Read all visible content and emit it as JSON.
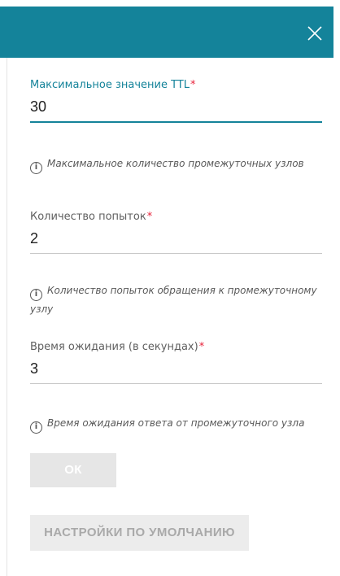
{
  "dialog": {
    "close_icon": "close-icon",
    "header_color": "#14839a"
  },
  "fields": {
    "ttl": {
      "label": "Максимальное значение TTL",
      "required_mark": "*",
      "value": "30",
      "hint": "Максимальное количество промежуточных узлов"
    },
    "attempts": {
      "label": "Количество попыток",
      "required_mark": "*",
      "value": "2",
      "hint": "Количество попыток обращения к промежуточному узлу"
    },
    "timeout": {
      "label": "Время ожидания (в секундах)",
      "required_mark": "*",
      "value": "3",
      "hint": "Время ожидания ответа от промежуточного узла"
    }
  },
  "hint_icon": "info-icon",
  "buttons": {
    "ok_label": "ОК",
    "defaults_label": "НАСТРОЙКИ ПО УМОЛЧАНИЮ"
  },
  "colors": {
    "accent": "#14839a",
    "required": "#e8243c",
    "button_disabled": "#e6e6e6"
  }
}
